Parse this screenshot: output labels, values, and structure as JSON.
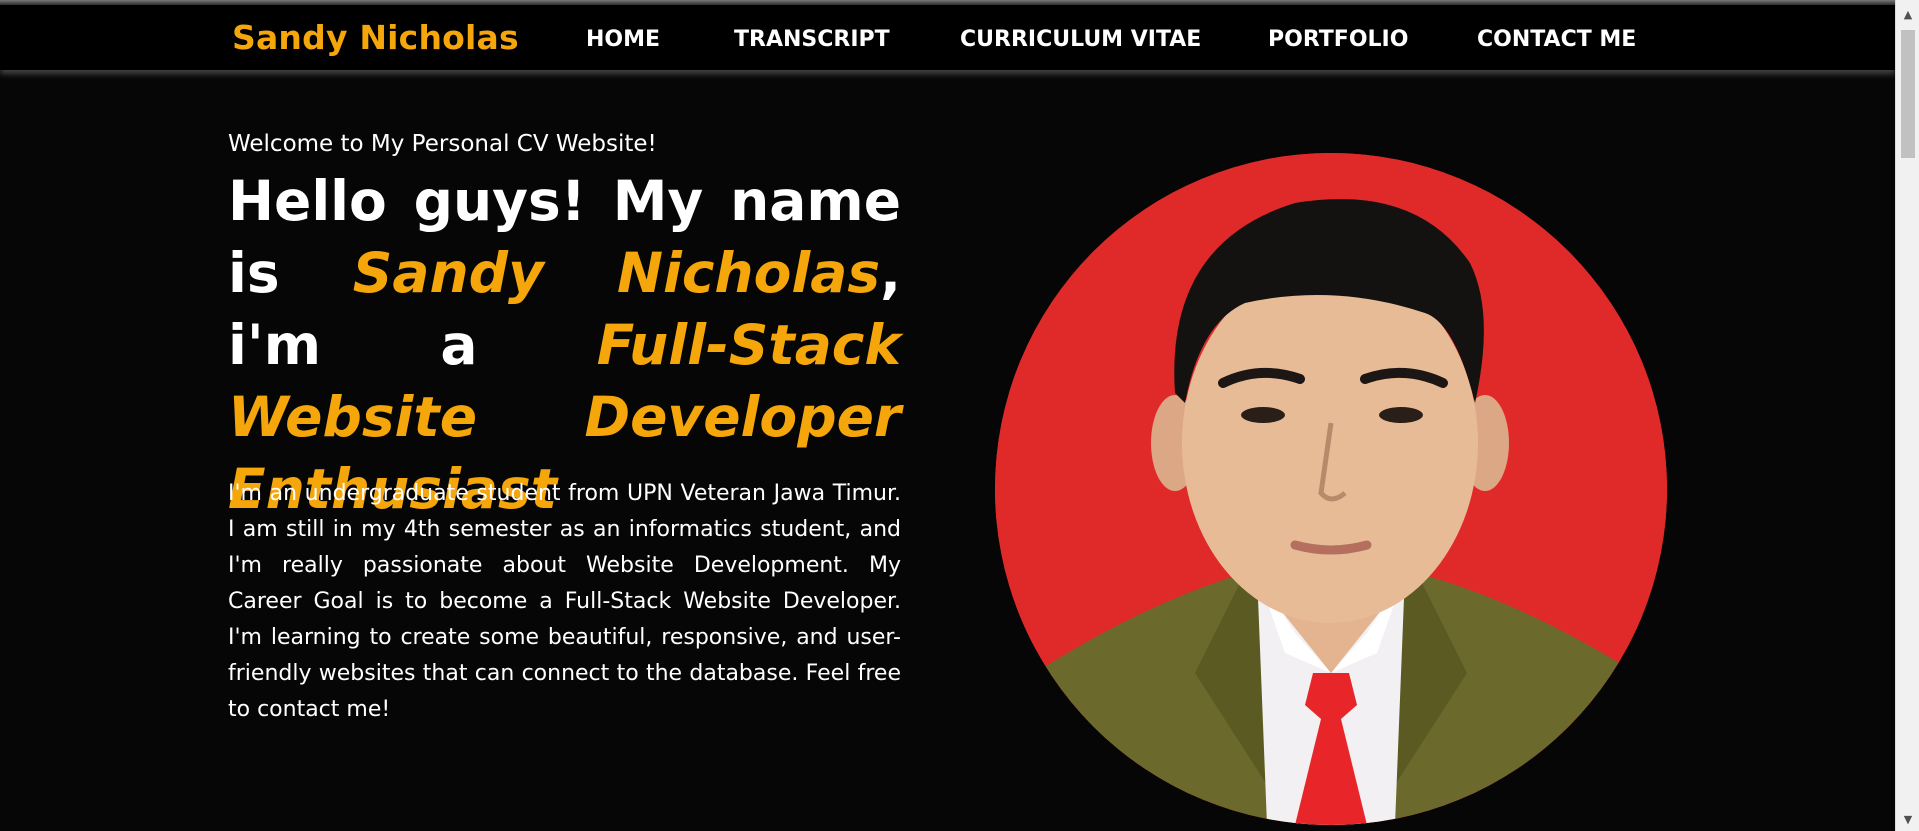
{
  "navbar": {
    "brand": "Sandy Nicholas",
    "links": [
      "HOME",
      "TRANSCRIPT",
      "CURRICULUM VITAE",
      "PORTFOLIO",
      "CONTACT ME"
    ]
  },
  "hero": {
    "welcome": "Welcome to My Personal CV Website!",
    "headline": {
      "part1": "Hello guys! My name is ",
      "name": "Sandy Nicholas",
      "part2": ", i'm a ",
      "role": "Full-Stack Website Developer Enthusiast"
    },
    "description": "I'm an undergraduate student from UPN Veteran Jawa Timur. I am still in my 4th semester as an informatics student, and I'm really passionate about Website Development. My Career Goal is to become a Full-Stack Website Developer. I'm learning to create some beautiful, responsive, and user-friendly websites that can connect to the database. Feel free to contact me!"
  },
  "colors": {
    "accent": "#f5a60a",
    "background": "#060606",
    "navbar": "#000000",
    "photo_background": "#e02a2a"
  },
  "icons": {
    "scroll_up": "scroll-up-arrow-icon",
    "scroll_down": "scroll-down-arrow-icon"
  }
}
